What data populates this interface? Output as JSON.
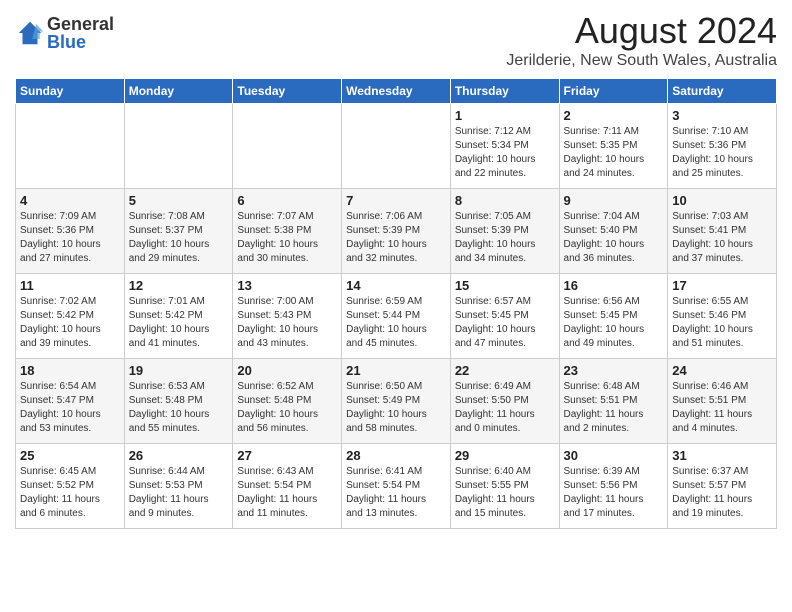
{
  "logo": {
    "general": "General",
    "blue": "Blue"
  },
  "title": {
    "month_year": "August 2024",
    "location": "Jerilderie, New South Wales, Australia"
  },
  "days_of_week": [
    "Sunday",
    "Monday",
    "Tuesday",
    "Wednesday",
    "Thursday",
    "Friday",
    "Saturday"
  ],
  "weeks": [
    [
      {
        "day": "",
        "info": ""
      },
      {
        "day": "",
        "info": ""
      },
      {
        "day": "",
        "info": ""
      },
      {
        "day": "",
        "info": ""
      },
      {
        "day": "1",
        "info": "Sunrise: 7:12 AM\nSunset: 5:34 PM\nDaylight: 10 hours\nand 22 minutes."
      },
      {
        "day": "2",
        "info": "Sunrise: 7:11 AM\nSunset: 5:35 PM\nDaylight: 10 hours\nand 24 minutes."
      },
      {
        "day": "3",
        "info": "Sunrise: 7:10 AM\nSunset: 5:36 PM\nDaylight: 10 hours\nand 25 minutes."
      }
    ],
    [
      {
        "day": "4",
        "info": "Sunrise: 7:09 AM\nSunset: 5:36 PM\nDaylight: 10 hours\nand 27 minutes."
      },
      {
        "day": "5",
        "info": "Sunrise: 7:08 AM\nSunset: 5:37 PM\nDaylight: 10 hours\nand 29 minutes."
      },
      {
        "day": "6",
        "info": "Sunrise: 7:07 AM\nSunset: 5:38 PM\nDaylight: 10 hours\nand 30 minutes."
      },
      {
        "day": "7",
        "info": "Sunrise: 7:06 AM\nSunset: 5:39 PM\nDaylight: 10 hours\nand 32 minutes."
      },
      {
        "day": "8",
        "info": "Sunrise: 7:05 AM\nSunset: 5:39 PM\nDaylight: 10 hours\nand 34 minutes."
      },
      {
        "day": "9",
        "info": "Sunrise: 7:04 AM\nSunset: 5:40 PM\nDaylight: 10 hours\nand 36 minutes."
      },
      {
        "day": "10",
        "info": "Sunrise: 7:03 AM\nSunset: 5:41 PM\nDaylight: 10 hours\nand 37 minutes."
      }
    ],
    [
      {
        "day": "11",
        "info": "Sunrise: 7:02 AM\nSunset: 5:42 PM\nDaylight: 10 hours\nand 39 minutes."
      },
      {
        "day": "12",
        "info": "Sunrise: 7:01 AM\nSunset: 5:42 PM\nDaylight: 10 hours\nand 41 minutes."
      },
      {
        "day": "13",
        "info": "Sunrise: 7:00 AM\nSunset: 5:43 PM\nDaylight: 10 hours\nand 43 minutes."
      },
      {
        "day": "14",
        "info": "Sunrise: 6:59 AM\nSunset: 5:44 PM\nDaylight: 10 hours\nand 45 minutes."
      },
      {
        "day": "15",
        "info": "Sunrise: 6:57 AM\nSunset: 5:45 PM\nDaylight: 10 hours\nand 47 minutes."
      },
      {
        "day": "16",
        "info": "Sunrise: 6:56 AM\nSunset: 5:45 PM\nDaylight: 10 hours\nand 49 minutes."
      },
      {
        "day": "17",
        "info": "Sunrise: 6:55 AM\nSunset: 5:46 PM\nDaylight: 10 hours\nand 51 minutes."
      }
    ],
    [
      {
        "day": "18",
        "info": "Sunrise: 6:54 AM\nSunset: 5:47 PM\nDaylight: 10 hours\nand 53 minutes."
      },
      {
        "day": "19",
        "info": "Sunrise: 6:53 AM\nSunset: 5:48 PM\nDaylight: 10 hours\nand 55 minutes."
      },
      {
        "day": "20",
        "info": "Sunrise: 6:52 AM\nSunset: 5:48 PM\nDaylight: 10 hours\nand 56 minutes."
      },
      {
        "day": "21",
        "info": "Sunrise: 6:50 AM\nSunset: 5:49 PM\nDaylight: 10 hours\nand 58 minutes."
      },
      {
        "day": "22",
        "info": "Sunrise: 6:49 AM\nSunset: 5:50 PM\nDaylight: 11 hours\nand 0 minutes."
      },
      {
        "day": "23",
        "info": "Sunrise: 6:48 AM\nSunset: 5:51 PM\nDaylight: 11 hours\nand 2 minutes."
      },
      {
        "day": "24",
        "info": "Sunrise: 6:46 AM\nSunset: 5:51 PM\nDaylight: 11 hours\nand 4 minutes."
      }
    ],
    [
      {
        "day": "25",
        "info": "Sunrise: 6:45 AM\nSunset: 5:52 PM\nDaylight: 11 hours\nand 6 minutes."
      },
      {
        "day": "26",
        "info": "Sunrise: 6:44 AM\nSunset: 5:53 PM\nDaylight: 11 hours\nand 9 minutes."
      },
      {
        "day": "27",
        "info": "Sunrise: 6:43 AM\nSunset: 5:54 PM\nDaylight: 11 hours\nand 11 minutes."
      },
      {
        "day": "28",
        "info": "Sunrise: 6:41 AM\nSunset: 5:54 PM\nDaylight: 11 hours\nand 13 minutes."
      },
      {
        "day": "29",
        "info": "Sunrise: 6:40 AM\nSunset: 5:55 PM\nDaylight: 11 hours\nand 15 minutes."
      },
      {
        "day": "30",
        "info": "Sunrise: 6:39 AM\nSunset: 5:56 PM\nDaylight: 11 hours\nand 17 minutes."
      },
      {
        "day": "31",
        "info": "Sunrise: 6:37 AM\nSunset: 5:57 PM\nDaylight: 11 hours\nand 19 minutes."
      }
    ]
  ]
}
